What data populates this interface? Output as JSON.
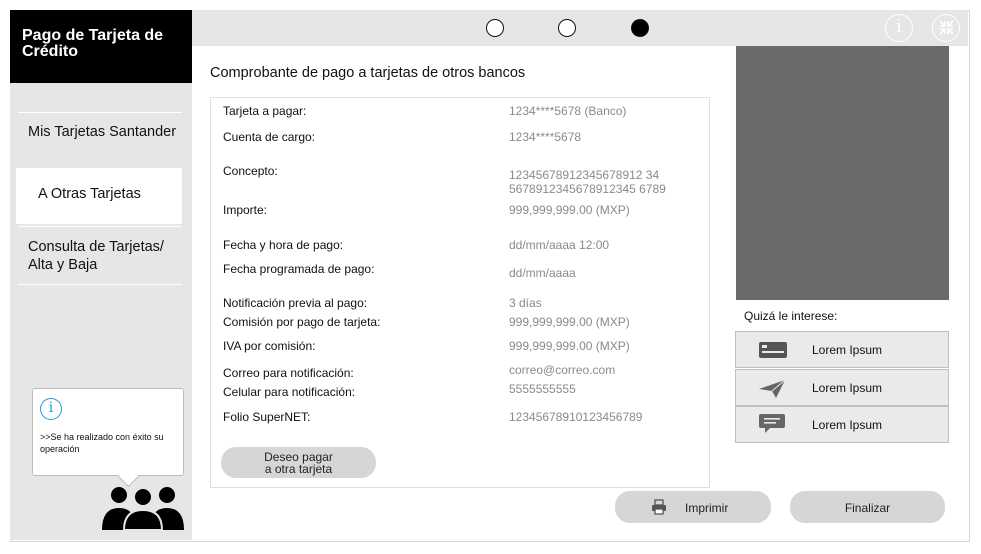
{
  "app": {
    "title": "Pago de Tarjeta de Crédito"
  },
  "sidebar": {
    "items": [
      {
        "label": "Mis Tarjetas Santander",
        "active": false
      },
      {
        "label": "A Otras Tarjetas",
        "active": true
      },
      {
        "label": "Consulta de Tarjetas/ Alta y Baja",
        "active": false
      }
    ],
    "info_message": ">>Se ha realizado con éxito su operación"
  },
  "stepper": {
    "total": 3,
    "current": 3
  },
  "main": {
    "title": "Comprobante de pago a tarjetas de otros bancos",
    "fields": [
      {
        "label": "Tarjeta a pagar:",
        "value": "1234****5678 (Banco)"
      },
      {
        "label": "Cuenta de cargo:",
        "value": "1234****5678"
      },
      {
        "label": "Concepto:",
        "value": "12345678912345678912345678912345678912345678 9"
      },
      {
        "label": "Importe:",
        "value": "999,999,999.00 (MXP)"
      },
      {
        "label": "Fecha y hora de pago:",
        "value": "dd/mm/aaaa 12:00"
      },
      {
        "label": "Fecha programada de pago:",
        "value": "dd/mm/aaaa"
      },
      {
        "label": "Notificación previa al pago:",
        "value": "3 días"
      },
      {
        "label": "Comisión por pago de tarjeta:",
        "value": "999,999,999.00 (MXP)"
      },
      {
        "label": "IVA por comisión:",
        "value": "999,999,999.00 (MXP)"
      },
      {
        "label": "Correo para notificación:",
        "value": "correo@correo.com"
      },
      {
        "label": "Celular para notificación:",
        "value": "5555555555"
      },
      {
        "label": "Folio SuperNET:",
        "value": "12345678910123456789"
      }
    ],
    "concept_lines": [
      "12345678912345678912 34",
      "5678912345678912345 6789"
    ],
    "pay_other_button": "Deseo pagar a otra tarjeta"
  },
  "actions": {
    "print": "Imprimir",
    "finish": "Finalizar"
  },
  "interest": {
    "title": "Quizá le interese:",
    "items": [
      {
        "label": "Lorem Ipsum",
        "icon": "card-icon"
      },
      {
        "label": "Lorem Ipsum",
        "icon": "paper-plane-icon"
      },
      {
        "label": "Lorem Ipsum",
        "icon": "chat-icon"
      }
    ]
  },
  "colors": {
    "brand_bg": "#000000",
    "sidebar_bg": "#e6e6e6",
    "accent_info": "#1aa0d8",
    "ad_placeholder": "#6a6a6a"
  }
}
